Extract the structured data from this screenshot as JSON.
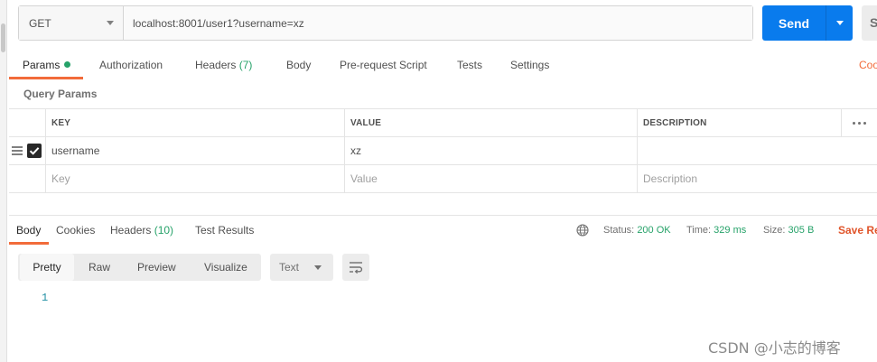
{
  "request": {
    "method": "GET",
    "url": "localhost:8001/user1?username=xz",
    "send_label": "Send",
    "save_label": "S"
  },
  "request_tabs": [
    {
      "label": "Params",
      "active": true
    },
    {
      "label": "Authorization"
    },
    {
      "label": "Headers",
      "count": "(7)"
    },
    {
      "label": "Body"
    },
    {
      "label": "Pre-request Script"
    },
    {
      "label": "Tests"
    },
    {
      "label": "Settings"
    }
  ],
  "cookies_link": "Coo",
  "query_params": {
    "title": "Query Params",
    "headers": {
      "key": "KEY",
      "value": "VALUE",
      "description": "DESCRIPTION"
    },
    "row": {
      "key": "username",
      "value": "xz",
      "description": ""
    },
    "placeholder": {
      "key": "Key",
      "value": "Value",
      "description": "Description"
    }
  },
  "response_tabs": [
    {
      "label": "Body",
      "active": true
    },
    {
      "label": "Cookies"
    },
    {
      "label": "Headers",
      "count": "(10)"
    },
    {
      "label": "Test Results"
    }
  ],
  "response_status": {
    "status_label": "Status:",
    "status_value": "200 OK",
    "time_label": "Time:",
    "time_value": "329 ms",
    "size_label": "Size:",
    "size_value": "305 B",
    "save_response": "Save Re"
  },
  "format_options": [
    "Pretty",
    "Raw",
    "Preview",
    "Visualize"
  ],
  "language_select": "Text",
  "body_line_number": "1",
  "watermark": "CSDN @小志的博客",
  "colors": {
    "accent": "#f26b3a",
    "send_blue": "#097bed",
    "success_green": "#26a269"
  }
}
